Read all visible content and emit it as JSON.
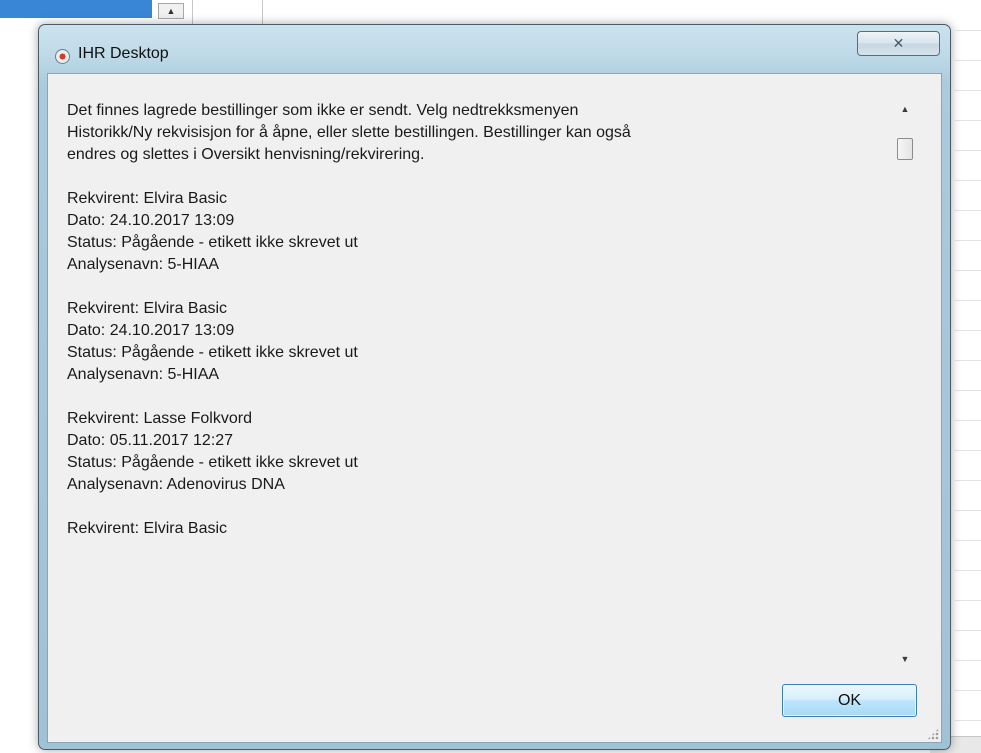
{
  "background": {
    "scroll_up_arrow": "▲"
  },
  "window": {
    "title": "IHR Desktop",
    "close_label": "✕",
    "accent_color": "#3c7fb1",
    "icon": "app-icon"
  },
  "message": {
    "intro": [
      "Det finnes lagrede bestillinger som ikke er sendt. Velg nedtrekksmenyen",
      "Historikk/Ny rekvisisjon for å åpne, eller slette bestillingen. Bestillinger kan også",
      "endres og slettes i Oversikt henvisning/rekvirering."
    ],
    "orders": [
      {
        "rekvirent": "Rekvirent: Elvira Basic",
        "dato": "Dato: 24.10.2017 13:09",
        "status": "Status: Pågående - etikett ikke skrevet ut",
        "analyse": "Analysenavn: 5-HIAA"
      },
      {
        "rekvirent": "Rekvirent: Elvira Basic",
        "dato": "Dato: 24.10.2017 13:09",
        "status": "Status: Pågående - etikett ikke skrevet ut",
        "analyse": "Analysenavn: 5-HIAA"
      },
      {
        "rekvirent": "Rekvirent: Lasse Folkvord",
        "dato": "Dato: 05.11.2017 12:27",
        "status": "Status: Pågående - etikett ikke skrevet ut",
        "analyse": "Analysenavn: Adenovirus DNA"
      }
    ],
    "partial_last": "Rekvirent: Elvira Basic"
  },
  "scrollbar": {
    "up_arrow": "▲",
    "down_arrow": "▼"
  },
  "buttons": {
    "ok_label": "OK"
  }
}
